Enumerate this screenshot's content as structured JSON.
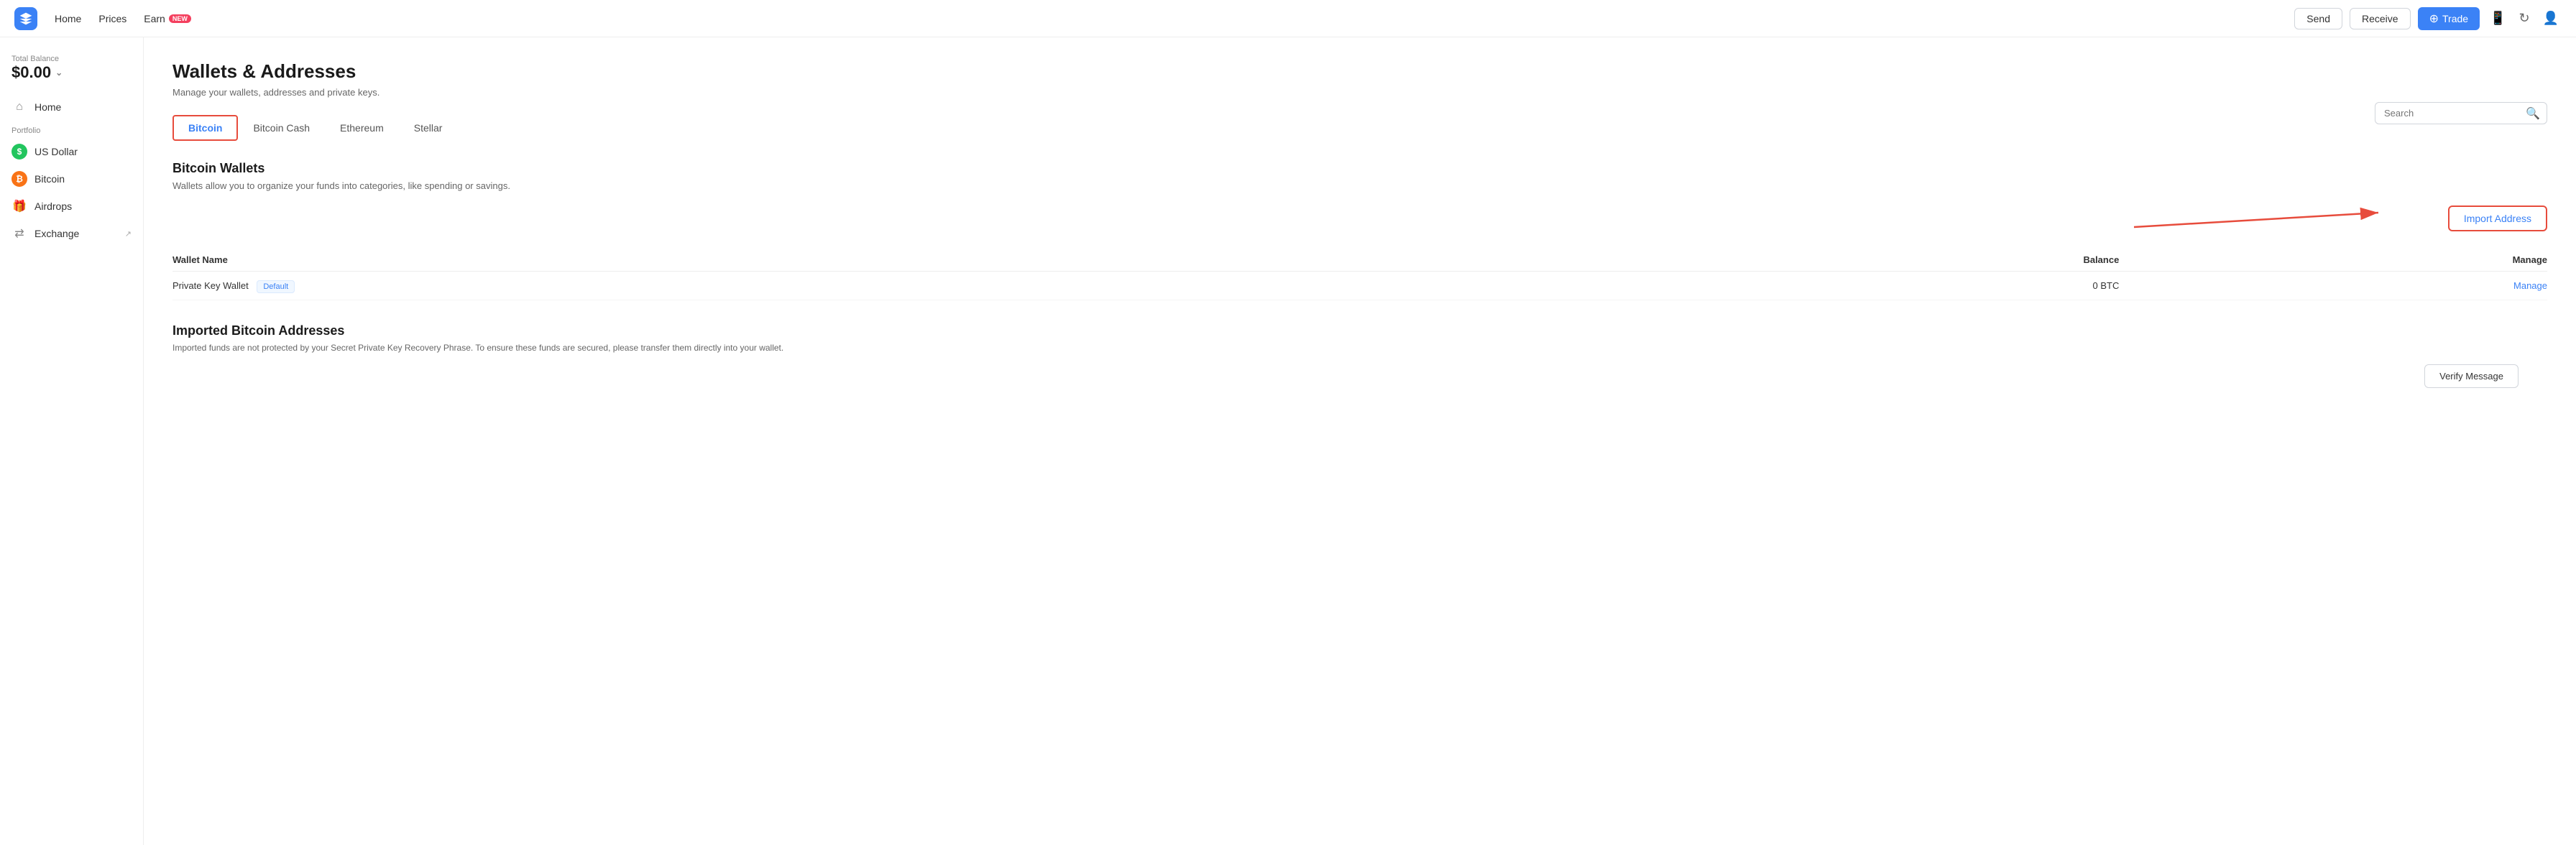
{
  "topnav": {
    "home_label": "Home",
    "prices_label": "Prices",
    "earn_label": "Earn",
    "new_badge": "NEW",
    "send_label": "Send",
    "receive_label": "Receive",
    "trade_label": "Trade"
  },
  "sidebar": {
    "balance_label": "Total Balance",
    "balance_amount": "$0.00",
    "portfolio_label": "Portfolio",
    "items": [
      {
        "id": "home",
        "label": "Home",
        "icon": "home"
      },
      {
        "id": "usdollar",
        "label": "US Dollar",
        "icon": "usd"
      },
      {
        "id": "bitcoin",
        "label": "Bitcoin",
        "icon": "btc"
      },
      {
        "id": "airdrops",
        "label": "Airdrops",
        "icon": "airdrops"
      },
      {
        "id": "exchange",
        "label": "Exchange",
        "icon": "exchange"
      }
    ]
  },
  "main": {
    "page_title": "Wallets & Addresses",
    "page_subtitle": "Manage your wallets, addresses and private keys.",
    "tabs": [
      {
        "id": "bitcoin",
        "label": "Bitcoin",
        "active": true
      },
      {
        "id": "bitcoin-cash",
        "label": "Bitcoin Cash",
        "active": false
      },
      {
        "id": "ethereum",
        "label": "Ethereum",
        "active": false
      },
      {
        "id": "stellar",
        "label": "Stellar",
        "active": false
      }
    ],
    "search_placeholder": "Search",
    "wallets_section_title": "Bitcoin Wallets",
    "wallets_section_desc": "Wallets allow you to organize your funds into categories, like spending or savings.",
    "import_address_label": "Import Address",
    "table": {
      "col_wallet_name": "Wallet Name",
      "col_balance": "Balance",
      "col_manage": "Manage",
      "rows": [
        {
          "name": "Private Key Wallet",
          "badge": "Default",
          "balance": "0 BTC",
          "manage": "Manage"
        }
      ]
    },
    "imported_section_title": "Imported Bitcoin Addresses",
    "imported_desc": "Imported funds are not protected by your Secret Private Key Recovery Phrase. To ensure these funds are secured, please transfer them directly into your wallet.",
    "verify_message_label": "Verify Message"
  }
}
